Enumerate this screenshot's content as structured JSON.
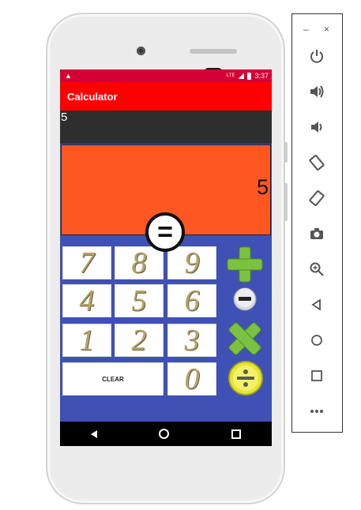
{
  "status_bar": {
    "time": "3:37",
    "warning_glyph": "▲",
    "network": "LTE"
  },
  "app_bar": {
    "title": "Calculator"
  },
  "input": {
    "value": "5"
  },
  "display": {
    "value": "5"
  },
  "equals_label": "=",
  "keys": {
    "row1": [
      "7",
      "8",
      "9"
    ],
    "row2": [
      "4",
      "5",
      "6"
    ],
    "row3": [
      "1",
      "2",
      "3"
    ],
    "clear": "CLEAR",
    "zero": "0"
  },
  "operators": [
    "plus-icon",
    "minus-icon",
    "multiply-icon",
    "divide-icon"
  ],
  "colors": {
    "status": "#d50035",
    "appbar": "#ff0000",
    "display": "#ff5722",
    "keypad": "#3f51b5",
    "op_green": "#7cc242",
    "op_yellow": "#e6e62e"
  },
  "panel": {
    "controls": {
      "minimize": "–",
      "close": "×"
    },
    "tools": [
      "power-icon",
      "volume-up-icon",
      "volume-down-icon",
      "rotate-left-icon",
      "rotate-right-icon",
      "camera-icon",
      "zoom-icon",
      "back-icon",
      "home-icon",
      "overview-icon",
      "more-icon"
    ]
  }
}
